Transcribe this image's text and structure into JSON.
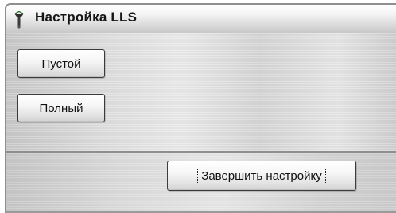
{
  "window": {
    "title": "Настройка LLS",
    "icon": "antenna-icon"
  },
  "buttons": {
    "empty_label": "Пустой",
    "full_label": "Полный",
    "finish_label": "Завершить настройку"
  },
  "colors": {
    "titlebar": "#e6e6e6",
    "panel": "#dedede",
    "button_border": "#3c3c3c",
    "text": "#111111"
  }
}
